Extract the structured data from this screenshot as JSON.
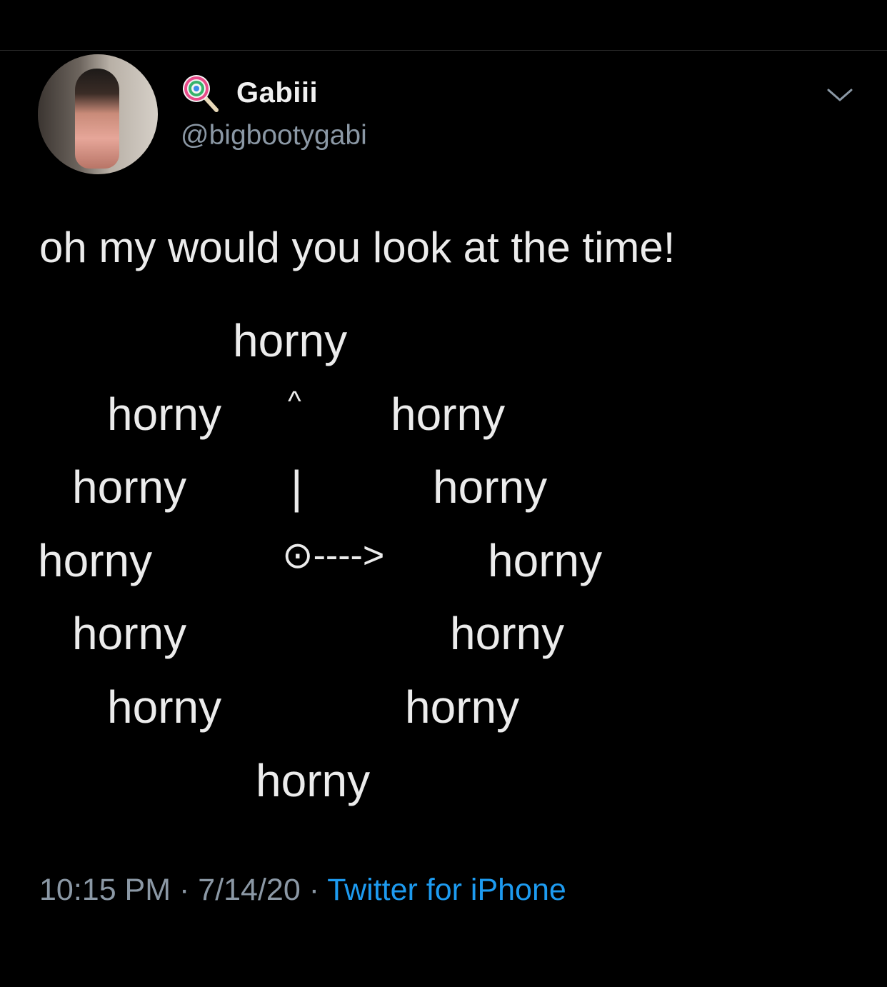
{
  "user": {
    "display_name": "Gabiii",
    "handle": "@bigbootygabi",
    "name_emoji": "lollipop-icon"
  },
  "tweet": {
    "text": "oh my would you look at the time!",
    "clock_lines": [
      "horny",
      "horny",
      "^",
      "horny",
      "horny",
      "|",
      "horny",
      "horny",
      "⊙---->",
      "horny",
      "horny",
      "horny",
      "horny",
      "horny",
      "horny"
    ]
  },
  "footer": {
    "time": "10:15 PM",
    "separator": " · ",
    "date": "7/14/20",
    "source": "Twitter for iPhone"
  },
  "colors": {
    "background": "#000000",
    "text": "#ececec",
    "secondary": "#8b98a5",
    "link": "#1d9bf0"
  }
}
